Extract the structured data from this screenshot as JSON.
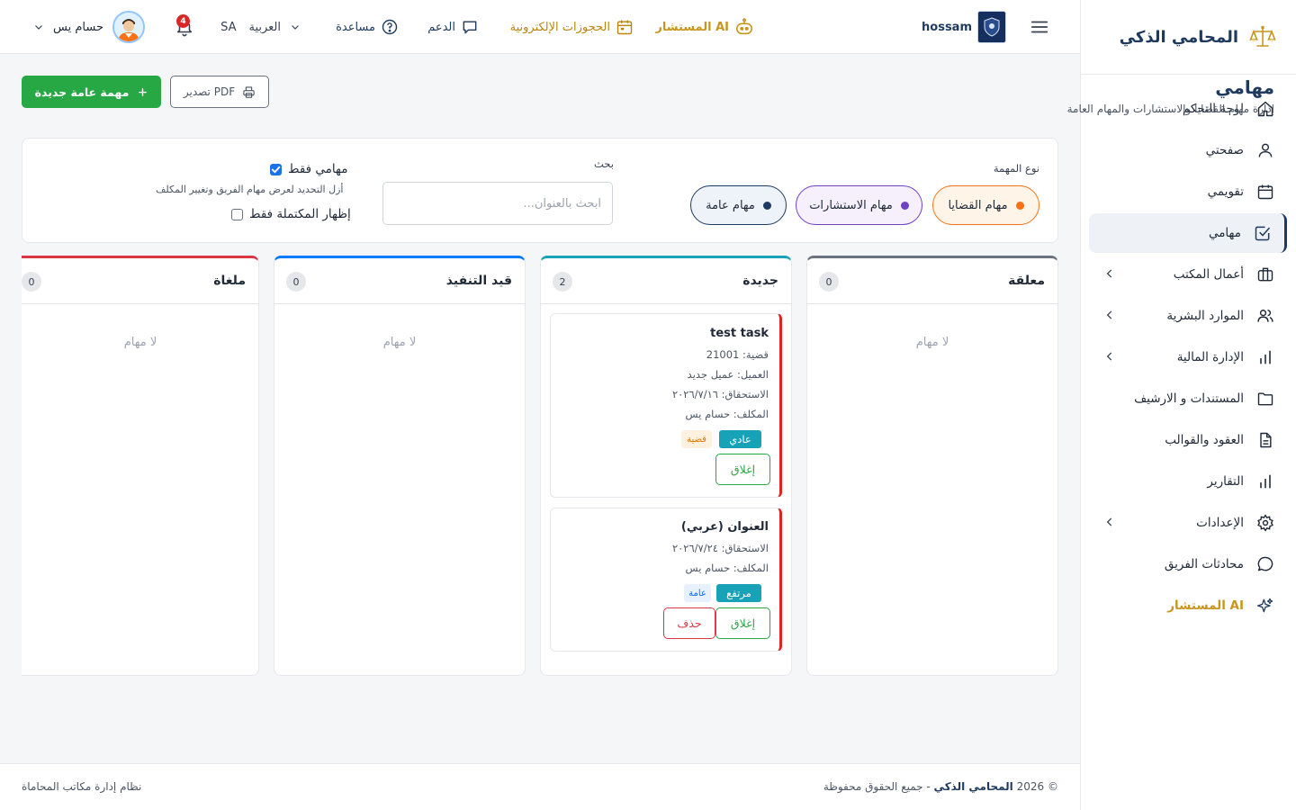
{
  "brand": {
    "name": "المحامي الذكي"
  },
  "nav": [
    {
      "label": "لوحة التحكم",
      "icon": "home-icon"
    },
    {
      "label": "صفحتي",
      "icon": "user-icon"
    },
    {
      "label": "تقويمي",
      "icon": "calendar-icon"
    },
    {
      "label": "مهامي",
      "icon": "task-check-icon",
      "active": true
    },
    {
      "label": "أعمال المكتب",
      "icon": "briefcase-icon",
      "expandable": true
    },
    {
      "label": "الموارد البشرية",
      "icon": "users-icon",
      "expandable": true
    },
    {
      "label": "الإدارة المالية",
      "icon": "bar-chart-icon",
      "expandable": true
    },
    {
      "label": "المستندات و الارشيف",
      "icon": "folder-icon"
    },
    {
      "label": "العقود والقوالب",
      "icon": "document-icon"
    },
    {
      "label": "التقارير",
      "icon": "bar-chart-icon"
    },
    {
      "label": "الإعدادات",
      "icon": "gear-icon",
      "expandable": true
    },
    {
      "label": "محادثات الفريق",
      "icon": "chat-icon"
    },
    {
      "label": "المستشار AI",
      "icon": "sparkle-icon"
    }
  ],
  "topbar": {
    "org_name": "hossam",
    "ai_label": "المستشار AI",
    "bookings_label": "الحجوزات الإلكترونية",
    "support_label": "الدعم",
    "help_label": "مساعدة",
    "lang_code": "SA",
    "lang_label": "العربية",
    "notif_count": "4",
    "user_name": "حسام يس"
  },
  "page": {
    "title": "مهامي",
    "subtitle": "إدارة مهام القضايا والاستشارات والمهام العامة",
    "new_task_label": "مهمة عامة جديدة",
    "export_label": "تصدير PDF"
  },
  "filters": {
    "type_label": "نوع المهمة",
    "pills": [
      "مهام القضايا",
      "مهام الاستشارات",
      "مهام عامة"
    ],
    "search_label": "بحث",
    "search_placeholder": "ابحث بالعنوان...",
    "my_tasks_label": "مهامي فقط",
    "my_tasks_hint": "أزل التحديد لعرض مهام الفريق وتغيير المكلف",
    "show_completed_label": "إظهار المكتملة فقط"
  },
  "columns": [
    {
      "title": "معلقة",
      "count": "0",
      "empty": "لا مهام",
      "color": "#6b7280"
    },
    {
      "title": "جديدة",
      "count": "2",
      "color": "#17a2b8"
    },
    {
      "title": "قيد التنفيذ",
      "count": "0",
      "empty": "لا مهام",
      "color": "#007bff"
    },
    {
      "title": "ملغاة",
      "count": "0",
      "empty": "لا مهام",
      "color": "#dc3545"
    }
  ],
  "cards": [
    {
      "title": "test task",
      "case": "قضية: 21001",
      "client": "العميل: عميل جديد",
      "due": "الاستحقاق: ٢٠٢٦/٧/١٦",
      "assignee": "المكلف: حسام يس",
      "priority": "عادي",
      "type": "قضية",
      "close_label": "إغلاق"
    },
    {
      "title": "العنوان (عربي)",
      "due": "الاستحقاق: ٢٠٢٦/٧/٢٤",
      "assignee": "المكلف: حسام يس",
      "priority": "مرتفع",
      "type": "عامة",
      "close_label": "إغلاق",
      "delete_label": "حذف"
    }
  ],
  "footer": {
    "copyright": "© 2026",
    "brand": "المحامي الذكي",
    "rights": "- جميع الحقوق محفوظة",
    "system": "نظام إدارة مكاتب المحاماة"
  }
}
